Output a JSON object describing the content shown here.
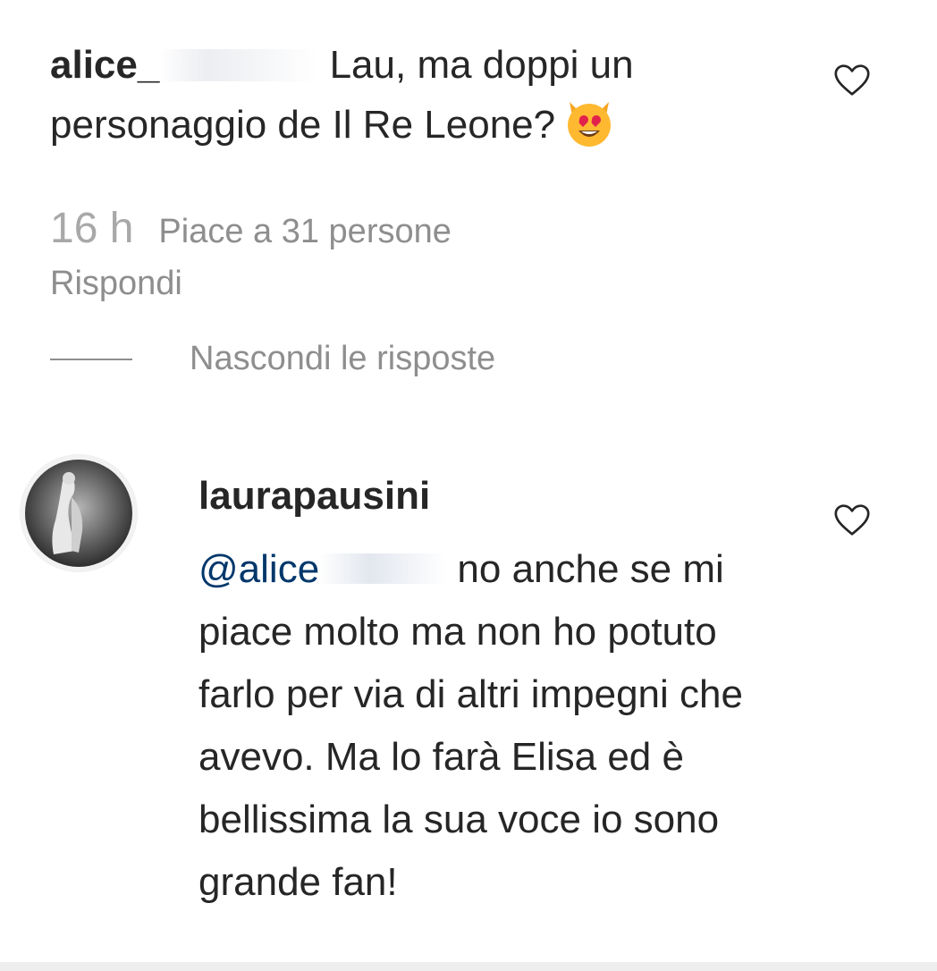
{
  "comment": {
    "username": "alice_",
    "text": "Lau, ma doppi un personaggio de Il Re Leone?",
    "emoji": "heart-eyes-cat-emoji",
    "time": "16 h",
    "likes": "Piace a 31 persone",
    "reply_label": "Rispondi",
    "like_icon": "heart-outline-icon"
  },
  "replies_toggle": {
    "label": "Nascondi le risposte"
  },
  "reply": {
    "username": "laurapausini",
    "mention": "@alice",
    "text": "no anche se mi piace molto ma non ho potuto farlo per via di altri impegni che avevo. Ma lo farà Elisa ed è bellissima la sua voce io sono grande fan!",
    "avatar": "profile-photo-avatar",
    "like_icon": "heart-outline-icon"
  },
  "colors": {
    "text": "#262626",
    "secondary": "#8e8e8e",
    "mention": "#00376b",
    "icon": "#262626"
  }
}
